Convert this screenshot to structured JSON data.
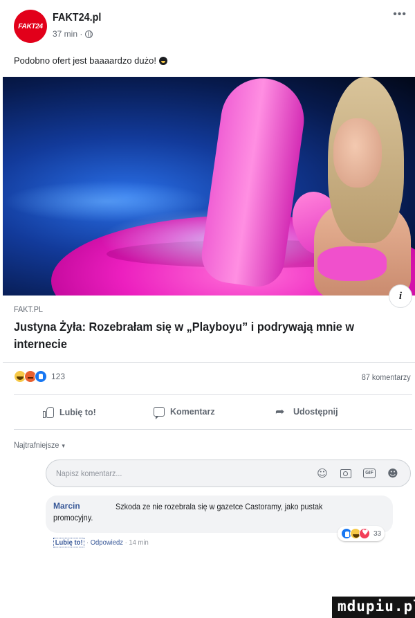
{
  "post": {
    "page_name": "FAKT24.pl",
    "avatar_text": "FAKT24",
    "time": "37 min ·",
    "text": "Podobno ofert jest baaaardzo dużo!"
  },
  "link": {
    "domain": "FAKT.PL",
    "title": "Justyna Żyła: Rozebrałam się w „Playboyu” i podrywają mnie w internecie"
  },
  "stats": {
    "reactions_count": "123",
    "comments_count": "87 komentarzy"
  },
  "actions": {
    "like": "Lubię to!",
    "comment": "Komentarz",
    "share": "Udostępnij"
  },
  "comments": {
    "sort_label": "Najtrafniejsze",
    "composer_placeholder": "Napisz komentarz...",
    "items": [
      {
        "author": "Marcin",
        "text": "Szkoda ze nie rozebrala się w gazetce Castoramy, jako pustak promocyjny.",
        "like_link": "Lubię to!",
        "reply_link": "Odpowiedz",
        "time": "14 min",
        "reactions_count": "33"
      }
    ]
  },
  "watermark": "mdupiu.pl",
  "colors": {
    "brand_red": "#e2001a",
    "link_blue": "#385898",
    "like_blue": "#1877f2",
    "flamingo_pink": "#ec1fbf"
  }
}
